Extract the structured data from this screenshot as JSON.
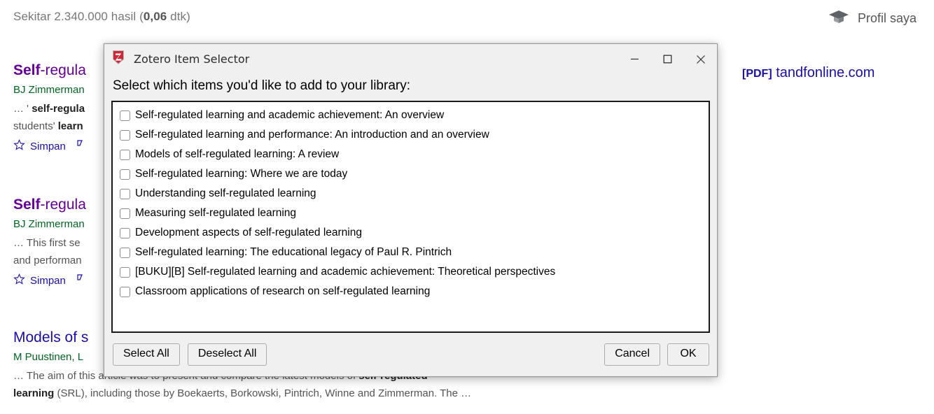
{
  "scholar": {
    "results_count_prefix": "Sekitar 2.340.000 hasil (",
    "results_count_time": "0,06",
    "results_count_suffix": " dtk)",
    "profile_label": "Profil saya",
    "profile_icon": "graduation-cap-icon",
    "pdf_tag": "[PDF]",
    "pdf_domain": "tandfonline.com",
    "results": [
      {
        "title_prefix": "Self",
        "title_rest": "-regula",
        "authors": "BJ Zimmerman",
        "snippet_line1_pre": "… ' ",
        "snippet_line1_bold": "self-regula",
        "snippet_line2_pre": "students' ",
        "snippet_line2_bold": "learn",
        "save_label": "Simpan"
      },
      {
        "title_prefix": "Self",
        "title_rest": "-regula",
        "authors": "BJ Zimmerman",
        "snippet_line1_pre": "… This first se",
        "snippet_line1_bold": "",
        "snippet_line2_pre": "and performan",
        "snippet_line2_bold": "",
        "save_label": "Simpan"
      },
      {
        "title_prefix": "Models of s",
        "title_rest": "",
        "authors": "M Puustinen, L",
        "snippet_line1_pre": "… The aim of this article was to present and compare the latest models of ",
        "snippet_line1_bold": "self-regulated",
        "snippet_line2_pre": " (SRL), including those by Boekaerts, Borkowski, Pintrich, Winne and Zimmerman. The …",
        "snippet_line2_bold": "learning",
        "save_label": ""
      }
    ]
  },
  "dialog": {
    "title": "Zotero Item Selector",
    "logo_icon": "zotero-logo-icon",
    "logo_letter": "Z",
    "prompt": "Select which items you'd like to add to your library:",
    "window_controls": [
      {
        "name": "minimize-button",
        "glyph": "minimize-icon"
      },
      {
        "name": "maximize-button",
        "glyph": "maximize-icon"
      },
      {
        "name": "close-button",
        "glyph": "close-icon"
      }
    ],
    "items": [
      {
        "label": "Self-regulated learning and academic achievement: An overview",
        "checked": false
      },
      {
        "label": "Self-regulated learning and performance: An introduction and an overview",
        "checked": false
      },
      {
        "label": "Models of self-regulated learning: A review",
        "checked": false
      },
      {
        "label": "Self-regulated learning: Where we are today",
        "checked": false
      },
      {
        "label": "Understanding self-regulated learning",
        "checked": false
      },
      {
        "label": "Measuring self-regulated learning",
        "checked": false
      },
      {
        "label": "Development aspects of self-regulated learning",
        "checked": false
      },
      {
        "label": "Self-regulated learning: The educational legacy of Paul R. Pintrich",
        "checked": false
      },
      {
        "label": "[BUKU][B] Self-regulated learning and academic achievement: Theoretical perspectives",
        "checked": false
      },
      {
        "label": "Classroom applications of research on self-regulated learning",
        "checked": false
      }
    ],
    "buttons": {
      "select_all": "Select All",
      "deselect_all": "Deselect All",
      "cancel": "Cancel",
      "ok": "OK"
    }
  },
  "colors": {
    "zotero_red": "#cc2936",
    "link_blue": "#1a0dab",
    "visited_purple": "#660099",
    "author_green": "#006621",
    "dialog_bg": "#f0f0f0"
  }
}
